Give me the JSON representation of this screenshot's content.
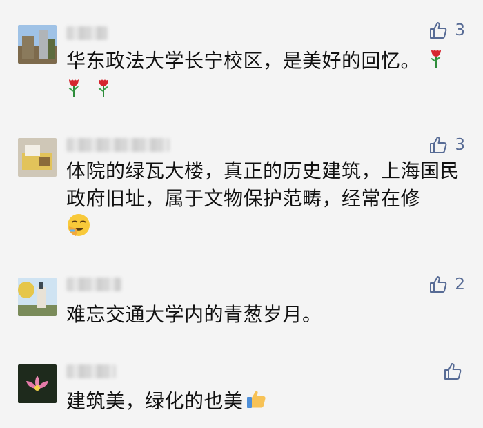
{
  "comments": [
    {
      "text": "华东政法大学长宁校区，是美好的回忆。",
      "likes": "3",
      "emoji": [
        "rose-icon",
        "rose-icon",
        "rose-icon"
      ]
    },
    {
      "text": "体院的绿瓦大楼，真正的历史建筑，上海国民政府旧址，属于文物保护范畴，经常在修",
      "likes": "3",
      "emoji": [
        "facepalm-laugh-icon"
      ]
    },
    {
      "text": "难忘交通大学内的青葱岁月。",
      "likes": "2",
      "emoji": []
    },
    {
      "text": "建筑美，绿化的也美",
      "likes": "",
      "emoji": [
        "thumbs-up-icon"
      ]
    }
  ],
  "colors": {
    "background": "#f4f4f4",
    "like_blue": "#576b95",
    "text": "#111111"
  }
}
